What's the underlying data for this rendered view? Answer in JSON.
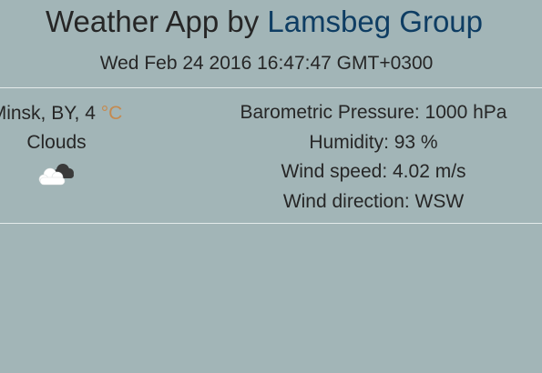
{
  "header": {
    "title_prefix": "Weather App by ",
    "title_brand": "Lamsbeg Group",
    "datetime": "Wed Feb 24 2016 16:47:47 GMT+0300"
  },
  "current": {
    "location": "Minsk, BY, ",
    "temperature": "4",
    "unit": " °C",
    "condition": "Clouds",
    "icon": "clouds-icon"
  },
  "details": {
    "pressure": "Barometric Pressure: 1000 hPa",
    "humidity": "Humidity: 93 %",
    "wind_speed": "Wind speed: 4.02 m/s",
    "wind_direction": "Wind direction: WSW"
  },
  "colors": {
    "background": "#a2b5b7",
    "brand": "#0e3d63",
    "unit": "#c58a4f",
    "divider": "#e3eaea"
  }
}
